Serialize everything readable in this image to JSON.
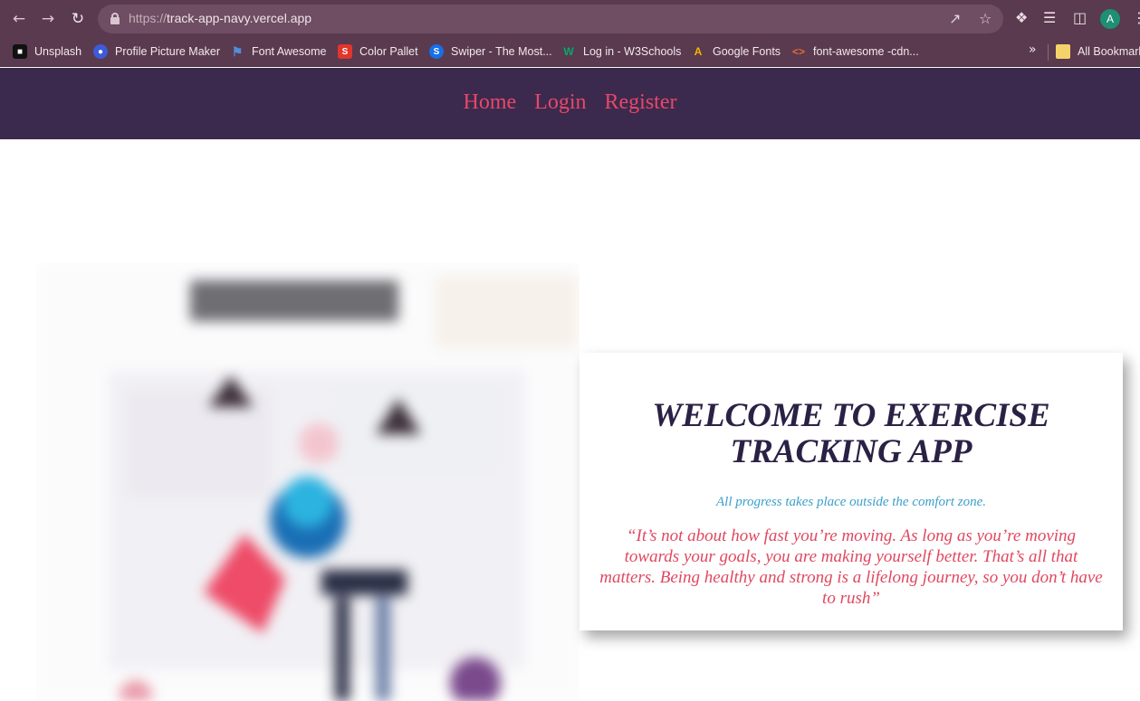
{
  "browser": {
    "url_scheme": "https://",
    "url_host": "track-app-navy.vercel.app",
    "profile_initial": "A",
    "bookmarks": [
      {
        "label": "Unsplash",
        "icon": "unsplash-icon",
        "color": "#111111"
      },
      {
        "label": "Profile Picture Maker",
        "icon": "profile-picture-maker-icon",
        "color": "#3d5bd9"
      },
      {
        "label": "Font Awesome",
        "icon": "font-awesome-flag-icon",
        "color": "#538dd7"
      },
      {
        "label": "Color Pallet",
        "icon": "color-pallet-icon",
        "color": "#e2352c"
      },
      {
        "label": "Swiper - The Most...",
        "icon": "swiper-icon",
        "color": "#1670e8"
      },
      {
        "label": "Log in - W3Schools",
        "icon": "w3schools-icon",
        "color": "#04aa6d"
      },
      {
        "label": "Google Fonts",
        "icon": "google-fonts-icon",
        "color": "#f4b400"
      },
      {
        "label": "font-awesome -cdn...",
        "icon": "code-icon",
        "color": "#e06a3b"
      }
    ],
    "all_bookmarks_label": "All Bookmarks"
  },
  "nav": {
    "links": [
      "Home",
      "Login",
      "Register"
    ]
  },
  "hero": {
    "title": "WELCOME TO EXERCISE TRACKING APP",
    "tagline": "All progress takes place outside the comfort zone.",
    "quote": "“It’s not about how fast you’re moving. As long as you’re moving towards your goals, you are making yourself better. That’s all that matters. Being healthy and strong is a lifelong journey, so you don’t have to rush”"
  },
  "colors": {
    "chrome": "#5a3a4e",
    "nav_bg": "#3b2a4d",
    "nav_link": "#e8476a",
    "title": "#2b2145",
    "tagline": "#3a9fc9",
    "quote": "#e0485f"
  }
}
